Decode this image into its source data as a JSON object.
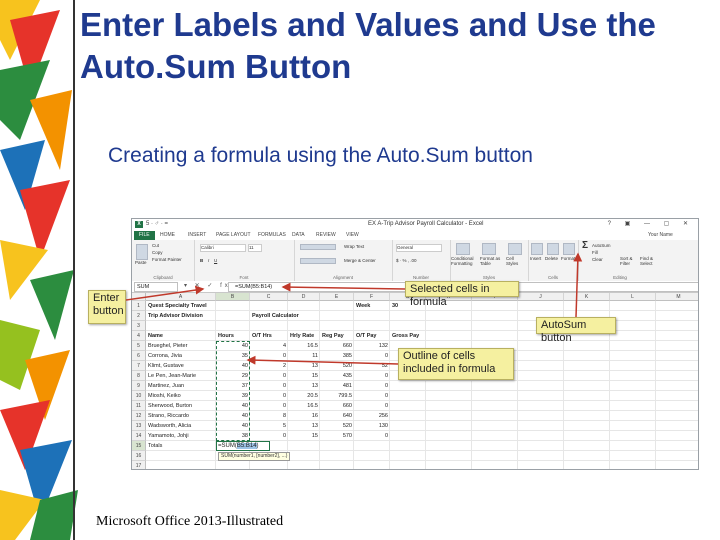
{
  "slide": {
    "title": "Enter Labels and Values and Use the Auto.Sum Button",
    "subtitle": "Creating a formula using the Auto.Sum button",
    "footer": "Microsoft Office 2013-Illustrated"
  },
  "window": {
    "title": "EX A-Trip Advisor Payroll Calculator - Excel",
    "qat": "5 · ♂ · =",
    "controls": "? ▣ — ▢ ✕",
    "user": "Your Name",
    "icon_label": "X"
  },
  "ribbon": {
    "tabs": [
      "FILE",
      "HOME",
      "INSERT",
      "PAGE LAYOUT",
      "FORMULAS",
      "DATA",
      "REVIEW",
      "VIEW"
    ],
    "clipboard": {
      "paste": "Paste",
      "cut": "Cut",
      "copy": "Copy",
      "format_painter": "Format Painter",
      "label": "Clipboard"
    },
    "font": {
      "name": "Calibri",
      "size": "11",
      "label": "Font"
    },
    "alignment": {
      "wrap": "Wrap Text",
      "merge": "Merge & Center",
      "label": "Alignment"
    },
    "number": {
      "format": "General",
      "label": "Number"
    },
    "styles": {
      "conditional": "Conditional Formatting",
      "format_table": "Format as Table",
      "cell_styles": "Cell Styles",
      "label": "Styles"
    },
    "cells": {
      "insert": "Insert",
      "delete": "Delete",
      "format": "Format",
      "label": "Cells"
    },
    "editing": {
      "autosum": "AutoSum",
      "fill": "Fill",
      "clear": "Clear",
      "sort": "Sort & Filter",
      "find": "Find & Select",
      "label": "Editing"
    }
  },
  "formula_bar": {
    "name_box": "SUM",
    "buttons": "▾ ✕ ✓ fx",
    "formula": "=SUM(B5:B14)"
  },
  "sheet": {
    "columns": [
      "A",
      "B",
      "C",
      "D",
      "E",
      "F",
      "G",
      "H",
      "I",
      "J",
      "K",
      "L",
      "M",
      "N"
    ],
    "rows": [
      "1",
      "2",
      "3",
      "4",
      "5",
      "6",
      "7",
      "8",
      "9",
      "10",
      "11",
      "12",
      "13",
      "14",
      "15",
      "16",
      "17"
    ],
    "row1": {
      "a": "Quest Specialty Travel",
      "f": "Week",
      "g": "30"
    },
    "row2": {
      "a": "Trip Advisor Division",
      "c": "Payroll Calculator"
    },
    "headers": [
      "Name",
      "Hours",
      "O/T Hrs",
      "Hrly Rate",
      "Reg Pay",
      "O/T Pay",
      "Gross Pay"
    ],
    "data": [
      [
        "Brueghel, Pieter",
        "40",
        "4",
        "16.5",
        "660",
        "132"
      ],
      [
        "Corrona, Jivia",
        "35",
        "0",
        "11",
        "385",
        "0"
      ],
      [
        "Klimt, Gustave",
        "40",
        "2",
        "13",
        "520",
        "52"
      ],
      [
        "Le Pen, Jean-Marie",
        "29",
        "0",
        "15",
        "435",
        "0"
      ],
      [
        "Martinez, Juan",
        "37",
        "0",
        "13",
        "481",
        "0"
      ],
      [
        "Mioshi, Keiko",
        "39",
        "0",
        "20.5",
        "799.5",
        "0"
      ],
      [
        "Sherwood, Burton",
        "40",
        "0",
        "16.5",
        "660",
        "0"
      ],
      [
        "Strano, Riccardo",
        "40",
        "8",
        "16",
        "640",
        "256"
      ],
      [
        "Wadsworth, Alicia",
        "40",
        "5",
        "13",
        "520",
        "130"
      ],
      [
        "Yamamoto, Johji",
        "38",
        "0",
        "15",
        "570",
        "0"
      ]
    ],
    "totals_label": "Totals",
    "formula_prefix": "=SUM(",
    "formula_ref": "B5:B14",
    "formula_suffix": ")",
    "tooltip": "SUM(number1, [number2], ...)"
  },
  "callouts": {
    "enter_button": "Enter button",
    "selected_cells": "Selected cells in formula",
    "autosum_button": "AutoSum button",
    "outline": "Outline of cells included in formula"
  },
  "colors": {
    "title": "#1f3a8f",
    "excel_green": "#217346",
    "callout_bg": "#f5f0a0",
    "arrow": "#c0392b"
  }
}
